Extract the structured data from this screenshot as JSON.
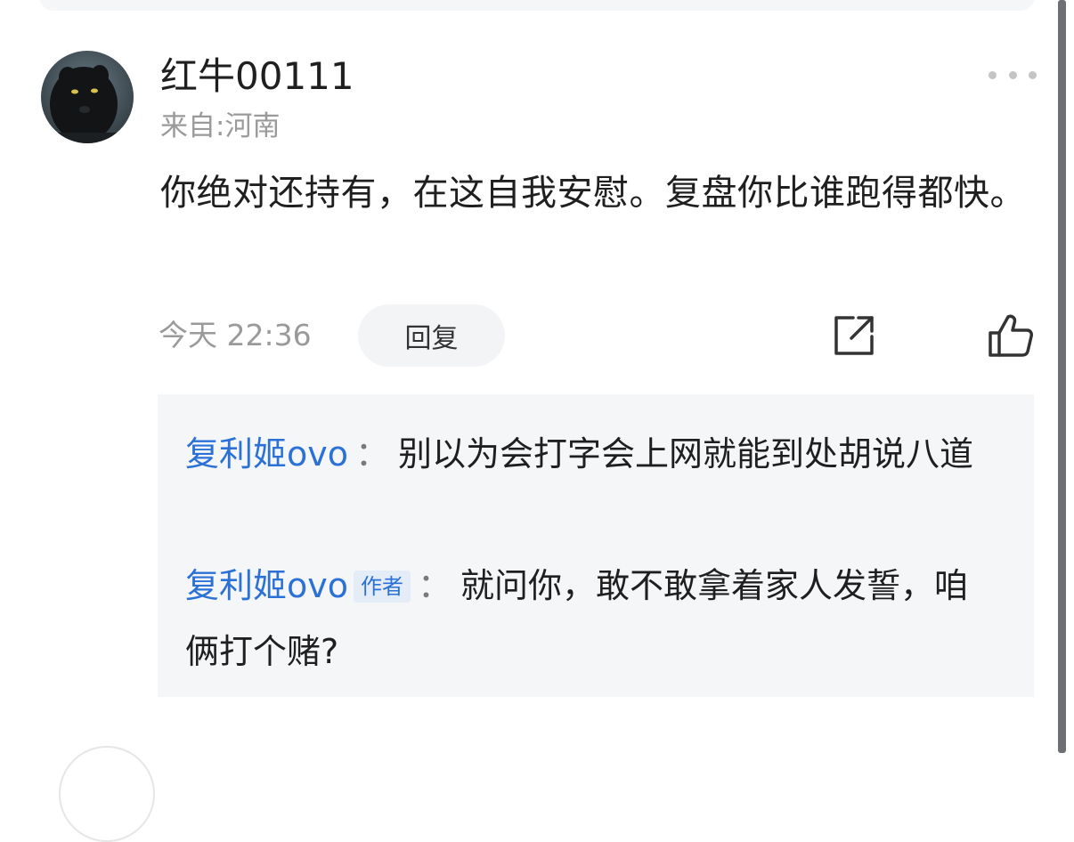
{
  "comment": {
    "username": "红牛00111",
    "location": "来自:河南",
    "text": "你绝对还持有，在这自我安慰。复盘你比谁跑得都快。",
    "timestamp": "今天 22:36",
    "reply_label": "回复",
    "icons": {
      "avatar": "black-panther-avatar",
      "more": "more-dots-icon",
      "share": "share-icon",
      "like": "thumbs-up-icon"
    }
  },
  "replies": [
    {
      "author": "复利姬ovo",
      "badge": "",
      "separator": "：",
      "text": "别以为会打字会上网就能到处胡说八道"
    },
    {
      "author": "复利姬ovo",
      "badge": "作者",
      "separator": "：",
      "text": "就问你，敢不敢拿着家人发誓，咱俩打个赌?"
    }
  ],
  "colors": {
    "link_blue": "#2b71d6",
    "muted_gray": "#9a9a9a",
    "reply_bg": "#f5f6f8"
  }
}
